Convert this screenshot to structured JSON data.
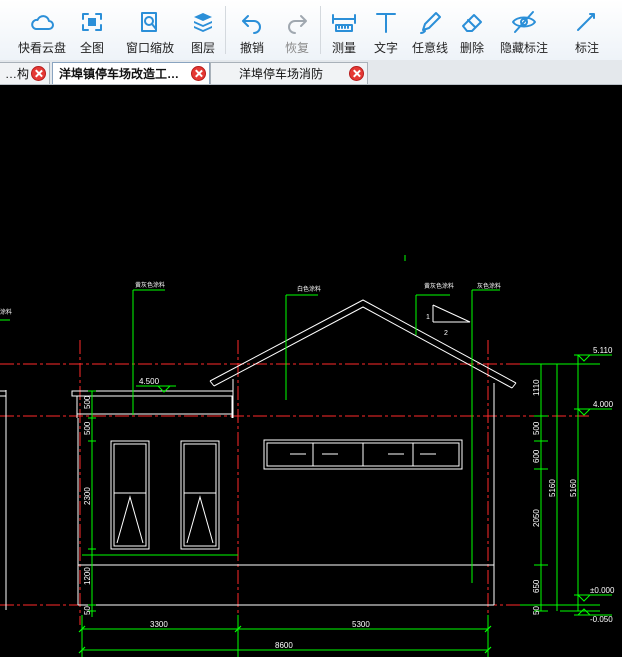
{
  "toolbar": {
    "items": [
      {
        "label": "快看云盘",
        "icon": "cloud-icon"
      },
      {
        "label": "全图",
        "icon": "fit-all-icon"
      },
      {
        "label": "窗口缩放",
        "icon": "window-zoom-icon"
      },
      {
        "label": "图层",
        "icon": "layers-icon"
      },
      {
        "label": "撤销",
        "icon": "undo-icon"
      },
      {
        "label": "恢复",
        "icon": "redo-icon"
      },
      {
        "label": "测量",
        "icon": "ruler-icon"
      },
      {
        "label": "文字",
        "icon": "text-icon"
      },
      {
        "label": "任意线",
        "icon": "pencil-icon"
      },
      {
        "label": "删除",
        "icon": "eraser-icon"
      },
      {
        "label": "隐藏标注",
        "icon": "eye-hidden-icon"
      },
      {
        "label": "标注",
        "icon": "annotation-icon"
      }
    ],
    "colors": {
      "accent": "#2b8fd8",
      "disabled": "#a0a8b0"
    }
  },
  "tabs": [
    {
      "title": "…构图…",
      "active": false
    },
    {
      "title": "洋埠镇停车场改造工…",
      "active": true
    },
    {
      "title": "洋埠停车场消防",
      "active": false
    }
  ],
  "drawing": {
    "colors": {
      "background": "#000000",
      "walls": "#ffffff",
      "dimensions": "#00ff00",
      "axes": "#ff0000"
    },
    "annotations": [
      "黄灰色涂料",
      "白色涂料",
      "黄灰色涂料",
      "灰色涂料",
      "涂料"
    ],
    "roof_slope": {
      "left": "1",
      "right": "2"
    },
    "elevations": [
      "5.110",
      "4.000",
      "±0.000",
      "-0.050"
    ],
    "parapet_elevation": "4.500",
    "vertical_dims_left": [
      "500",
      "500",
      "2300",
      "1200",
      "50"
    ],
    "vertical_dims_right": [
      "1110",
      "500",
      "600",
      "2050",
      "650",
      "50"
    ],
    "total_heights": [
      "5160",
      "5160"
    ],
    "horizontal_dims": [
      "3300",
      "5300"
    ],
    "total_width": "8600"
  }
}
